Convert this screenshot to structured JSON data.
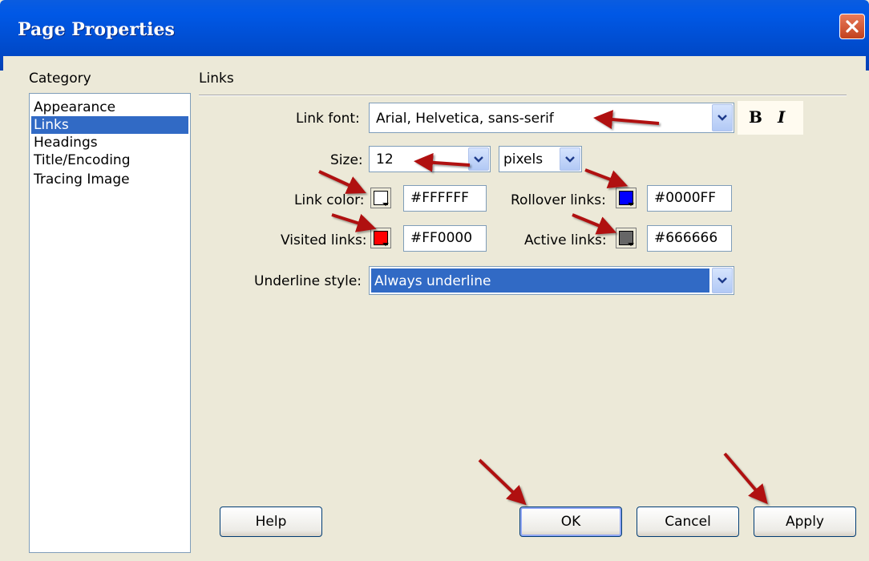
{
  "window": {
    "title": "Page Properties"
  },
  "category": {
    "label": "Category",
    "items": [
      "Appearance",
      "Links",
      "Headings",
      "Title/Encoding",
      "Tracing Image"
    ],
    "selected": "Links"
  },
  "section": {
    "title": "Links"
  },
  "link_font": {
    "label": "Link font:",
    "value": "Arial, Helvetica, sans-serif",
    "bold": "B",
    "italic": "I"
  },
  "size": {
    "label": "Size:",
    "value": "12",
    "unit": "pixels"
  },
  "link_color": {
    "label": "Link color:",
    "value": "#FFFFFF",
    "color": "#FFFFFF"
  },
  "rollover_links": {
    "label": "Rollover links:",
    "value": "#0000FF",
    "color": "#0000FF"
  },
  "visited_links": {
    "label": "Visited links:",
    "value": "#FF0000",
    "color": "#FF0000"
  },
  "active_links": {
    "label": "Active links:",
    "value": "#666666",
    "color": "#666666"
  },
  "underline_style": {
    "label": "Underline style:",
    "value": "Always underline"
  },
  "buttons": {
    "help": "Help",
    "ok": "OK",
    "cancel": "Cancel",
    "apply": "Apply"
  },
  "icons": {
    "close": "close-icon",
    "dropdown": "chevron-down-icon",
    "annotation": "red-arrow-icon"
  },
  "colors": {
    "titlebar": "#0054E3",
    "selection": "#316AC5",
    "annotation_arrow": "#B01010"
  }
}
